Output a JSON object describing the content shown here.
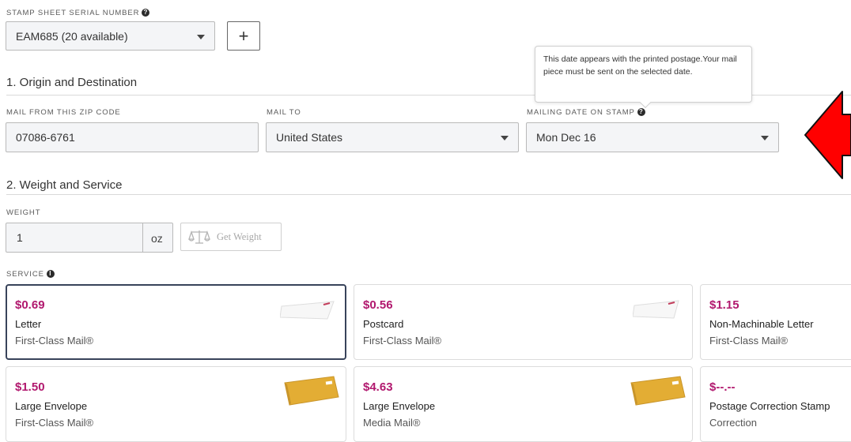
{
  "stamp_sheet": {
    "label": "STAMP SHEET SERIAL NUMBER",
    "selected": "EAM685 (20 available)",
    "add_label": "+"
  },
  "origin": {
    "title": "1. Origin and Destination",
    "from_label": "MAIL FROM THIS ZIP CODE",
    "from_value": "07086-6761",
    "to_label": "MAIL TO",
    "to_value": "United States",
    "date_label": "MAILING DATE ON STAMP",
    "date_value": "Mon Dec 16",
    "tooltip": "This date appears with the printed postage.Your mail piece must be sent on the selected date."
  },
  "weight": {
    "title": "2. Weight and Service",
    "label": "WEIGHT",
    "value": "1",
    "unit": "oz",
    "get_weight_label": "Get Weight"
  },
  "service": {
    "label": "SERVICE",
    "cards": [
      {
        "price": "$0.69",
        "name": "Letter",
        "cls": "First-Class Mail®",
        "icon": "letter-envelope-icon"
      },
      {
        "price": "$0.56",
        "name": "Postcard",
        "cls": "First-Class Mail®",
        "icon": "postcard-icon"
      },
      {
        "price": "$1.15",
        "name": "Non-Machinable Letter",
        "cls": "First-Class Mail®",
        "icon": ""
      },
      {
        "price": "$1.50",
        "name": "Large Envelope",
        "cls": "First-Class Mail®",
        "icon": "large-envelope-icon"
      },
      {
        "price": "$4.63",
        "name": "Large Envelope",
        "cls": "Media Mail®",
        "icon": "large-envelope-icon"
      },
      {
        "price": "$--.--",
        "name": "Postage Correction Stamp",
        "cls": "Correction",
        "icon": ""
      }
    ]
  },
  "colors": {
    "price": "#b1186e",
    "selected_border": "#38435a",
    "annotation_arrow": "#ff0000"
  }
}
